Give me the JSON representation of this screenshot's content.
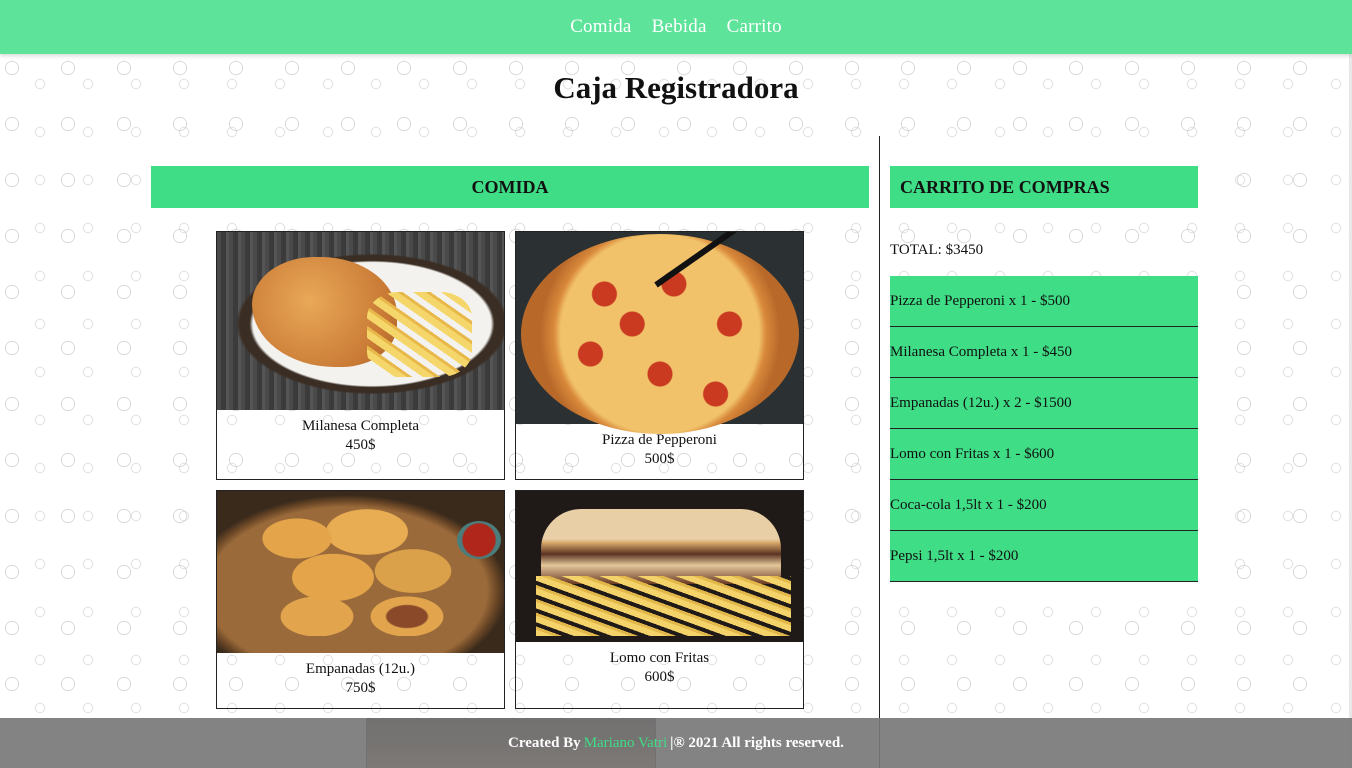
{
  "nav": {
    "items": [
      "Comida",
      "Bebida",
      "Carrito"
    ]
  },
  "title": "Caja Registradora",
  "menu": {
    "heading": "COMIDA",
    "items": [
      {
        "name": "Milanesa Completa",
        "price": "450$"
      },
      {
        "name": "Pizza de Pepperoni",
        "price": "500$"
      },
      {
        "name": "Empanadas (12u.)",
        "price": "750$"
      },
      {
        "name": "Lomo con Fritas",
        "price": "600$"
      }
    ]
  },
  "cart": {
    "heading": "CARRITO DE COMPRAS",
    "total": "TOTAL: $3450",
    "items": [
      "Pizza de Pepperoni x 1 - $500",
      "Milanesa Completa x 1 - $450",
      "Empanadas (12u.) x 2 - $1500",
      "Lomo con Fritas x 1 - $600",
      "Coca-cola 1,5lt x 1 - $200",
      "Pepsi 1,5lt x 1 - $200"
    ]
  },
  "footer": {
    "prefix": "Created By",
    "author": "Mariano Vatri",
    "suffix": "|® 2021 All rights reserved."
  },
  "colors": {
    "nav_bg": "#5ee39a",
    "accent": "#3fdd86",
    "footer_bg": "#787878"
  }
}
